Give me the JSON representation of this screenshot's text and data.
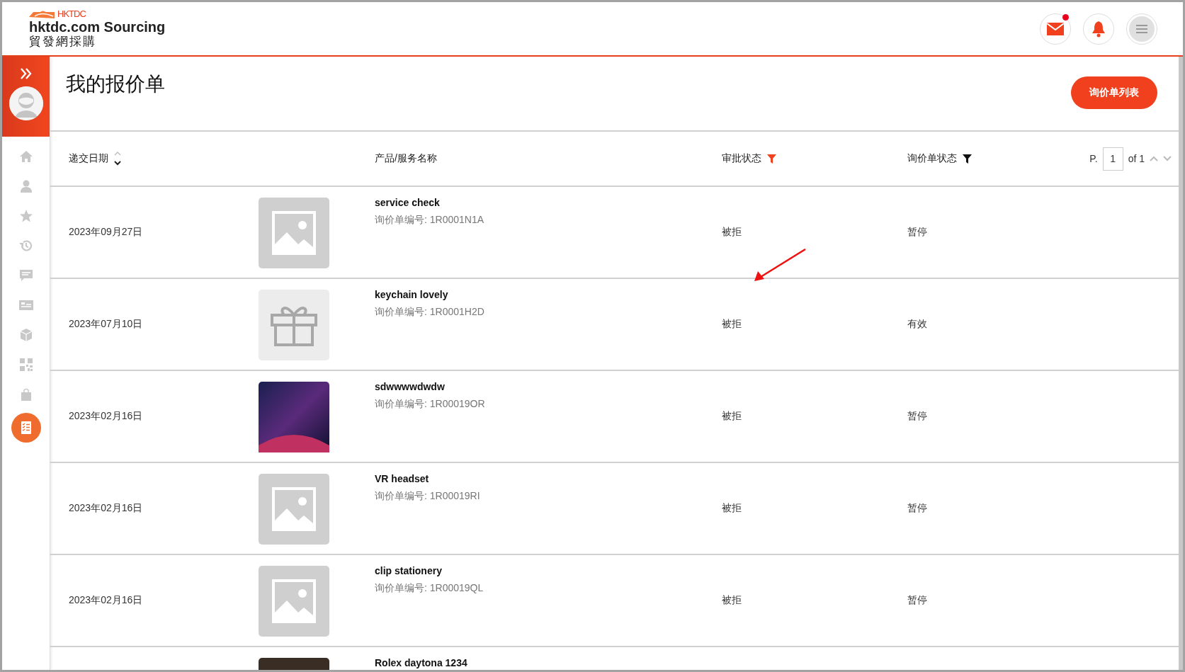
{
  "header": {
    "logo_mark": "HKTDC",
    "site_name": "hktdc.com Sourcing",
    "site_name_chinese": "貿發網採購",
    "mail_unread": true
  },
  "sidebar": {
    "items": [
      {
        "kind": "home",
        "selected": false
      },
      {
        "kind": "user",
        "selected": false
      },
      {
        "kind": "star",
        "selected": false
      },
      {
        "kind": "history",
        "selected": false
      },
      {
        "kind": "chat",
        "selected": false
      },
      {
        "kind": "card",
        "selected": false
      },
      {
        "kind": "cube",
        "selected": false
      },
      {
        "kind": "qr",
        "selected": false
      },
      {
        "kind": "bag",
        "selected": false
      },
      {
        "kind": "checklist",
        "selected": true
      }
    ]
  },
  "page": {
    "title": "我的报价单",
    "action_button": "询价单列表"
  },
  "table": {
    "columns": [
      {
        "label": "递交日期",
        "sort_descending": true
      },
      {
        "label": "产品/服务名称"
      },
      {
        "label": "审批状态",
        "filter_active": true
      },
      {
        "label": "询价单状态",
        "filter_active": false
      }
    ],
    "pager": {
      "prefix": "P.",
      "page": "1",
      "total": "of 1"
    },
    "rows": [
      {
        "date": "2023年09月27日",
        "kind": "placeholder",
        "name": "service check",
        "number": "询价单编号: 1R0001N1A",
        "approval": "被拒",
        "status": "暂停"
      },
      {
        "date": "2023年07月10日",
        "kind": "gift",
        "name": "keychain lovely",
        "number": "询价单编号: 1R0001H2D",
        "approval": "被拒",
        "status": "有效"
      },
      {
        "date": "2023年02月16日",
        "kind": "photo",
        "name": "sdwwwwdwdw",
        "number": "询价单编号: 1R00019OR",
        "approval": "被拒",
        "status": "暂停"
      },
      {
        "date": "2023年02月16日",
        "kind": "placeholder",
        "name": "VR headset",
        "number": "询价单编号: 1R00019RI",
        "approval": "被拒",
        "status": "暂停"
      },
      {
        "date": "2023年02月16日",
        "kind": "placeholder",
        "name": "clip stationery",
        "number": "询价单编号: 1R00019QL",
        "approval": "被拒",
        "status": "暂停"
      },
      {
        "kind": "dark-photo",
        "name": "Rolex daytona 1234"
      }
    ]
  }
}
